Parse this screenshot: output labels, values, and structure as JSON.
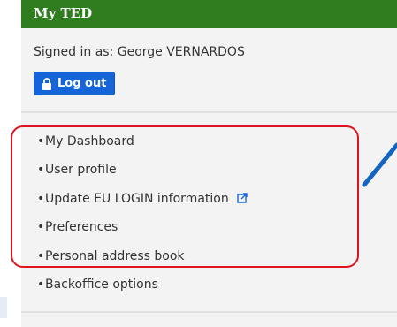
{
  "header": {
    "title": "My TED"
  },
  "user": {
    "signed_in_text": "Signed in as: George VERNARDOS",
    "logout_label": "Log out"
  },
  "menu": {
    "items": [
      {
        "label": "My Dashboard"
      },
      {
        "label": "User profile"
      },
      {
        "label": "Update EU LOGIN information",
        "icon": "external-link-icon"
      },
      {
        "label": "Preferences"
      },
      {
        "label": "Personal address book"
      },
      {
        "label": "Backoffice options"
      }
    ]
  },
  "colors": {
    "header_bg": "#2f7d1f",
    "button_bg": "#1565d8",
    "highlight": "#e0141e",
    "arrow": "#1565c0"
  }
}
